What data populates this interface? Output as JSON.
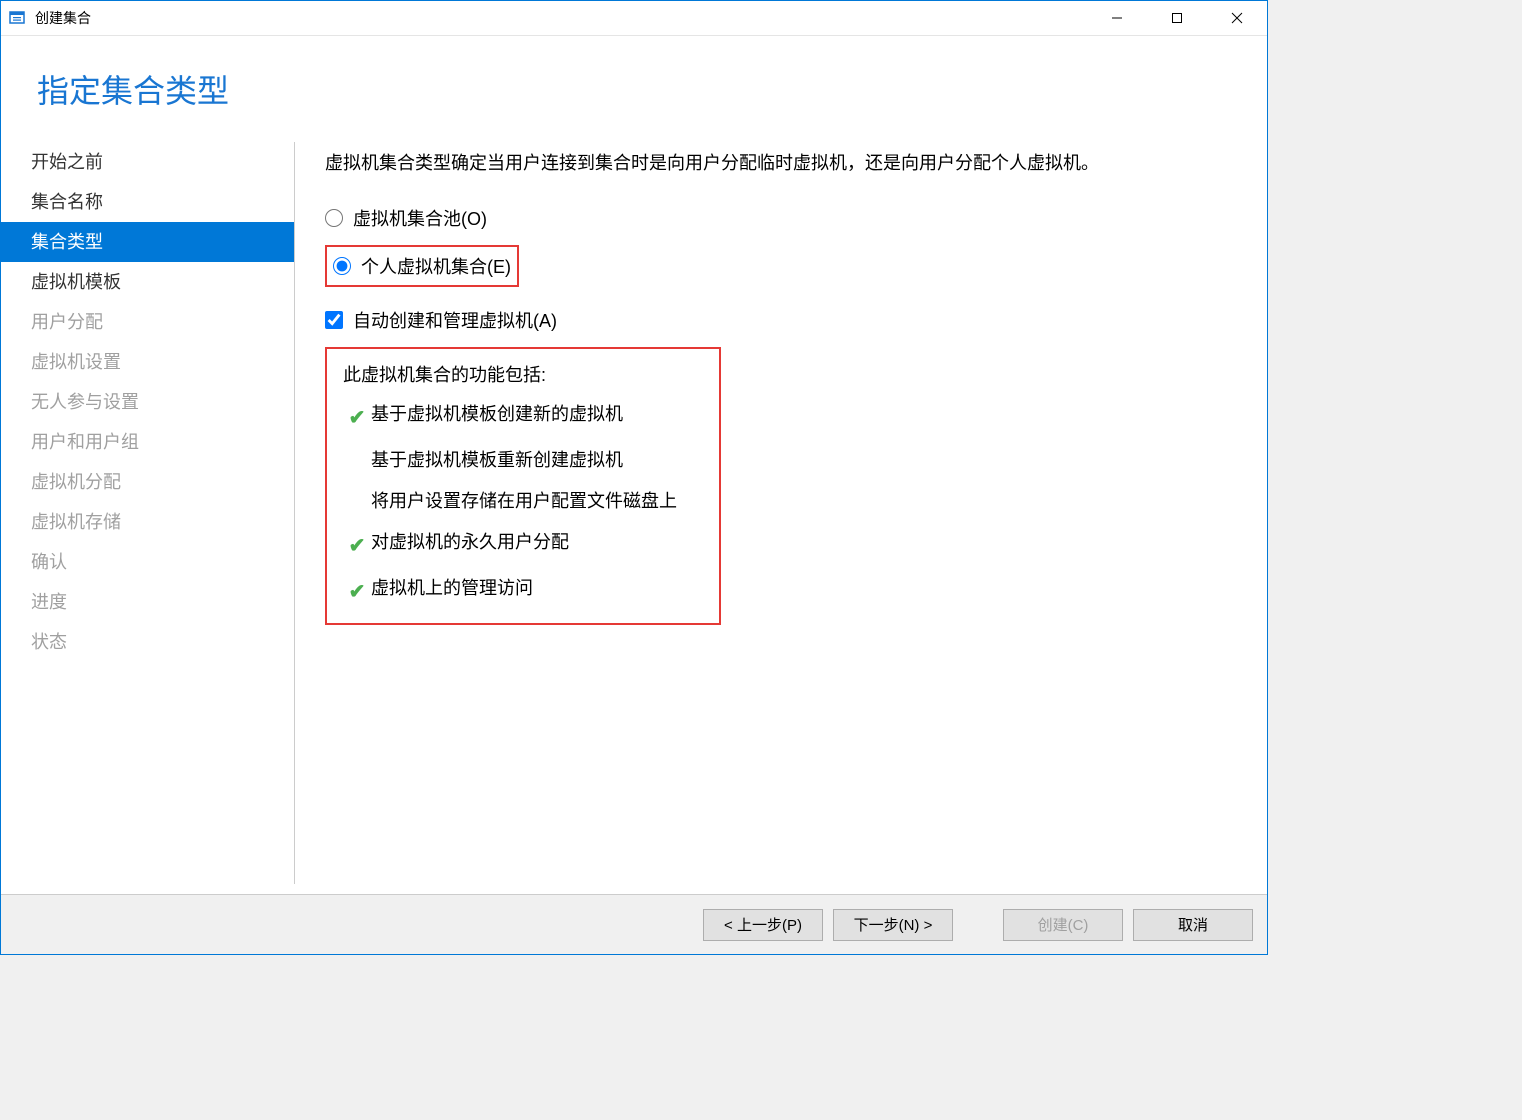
{
  "window": {
    "title": "创建集合"
  },
  "header": {
    "page_title": "指定集合类型"
  },
  "sidebar": {
    "items": [
      {
        "label": "开始之前",
        "state": "normal"
      },
      {
        "label": "集合名称",
        "state": "normal"
      },
      {
        "label": "集合类型",
        "state": "selected"
      },
      {
        "label": "虚拟机模板",
        "state": "normal"
      },
      {
        "label": "用户分配",
        "state": "disabled"
      },
      {
        "label": "虚拟机设置",
        "state": "disabled"
      },
      {
        "label": "无人参与设置",
        "state": "disabled"
      },
      {
        "label": "用户和用户组",
        "state": "disabled"
      },
      {
        "label": "虚拟机分配",
        "state": "disabled"
      },
      {
        "label": "虚拟机存储",
        "state": "disabled"
      },
      {
        "label": "确认",
        "state": "disabled"
      },
      {
        "label": "进度",
        "state": "disabled"
      },
      {
        "label": "状态",
        "state": "disabled"
      }
    ]
  },
  "content": {
    "description": "虚拟机集合类型确定当用户连接到集合时是向用户分配临时虚拟机，还是向用户分配个人虚拟机。",
    "radio_pool": "虚拟机集合池(O)",
    "radio_personal": "个人虚拟机集合(E)",
    "checkbox_auto": "自动创建和管理虚拟机(A)",
    "features_title": "此虚拟机集合的功能包括:",
    "features": [
      {
        "check": true,
        "text": "基于虚拟机模板创建新的虚拟机"
      },
      {
        "check": false,
        "text": "基于虚拟机模板重新创建虚拟机"
      },
      {
        "check": false,
        "text": "将用户设置存储在用户配置文件磁盘上"
      },
      {
        "check": true,
        "text": "对虚拟机的永久用户分配"
      },
      {
        "check": true,
        "text": "虚拟机上的管理访问"
      }
    ]
  },
  "footer": {
    "prev": "< 上一步(P)",
    "next": "下一步(N) >",
    "create": "创建(C)",
    "cancel": "取消"
  }
}
